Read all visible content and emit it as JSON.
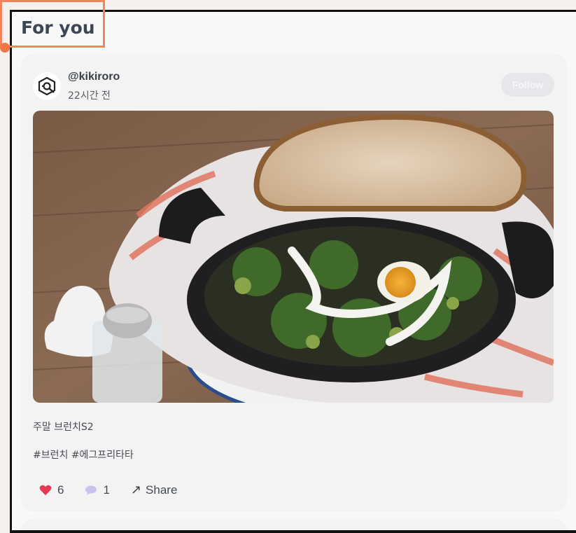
{
  "feed": {
    "section_title": "For you"
  },
  "post": {
    "username": "@kikiroro",
    "time_ago": "22시간 전",
    "follow_label": "Follow",
    "caption": "주말 브런치S2",
    "hashtags": "#브런치 #에그프리타타",
    "likes": "6",
    "comments": "1",
    "share_label": "Share",
    "avatar_icon": "abstract-logo-icon",
    "photo_desc_icon": "food-photo"
  },
  "colors": {
    "highlight": "#f2845b",
    "like": "#e53955",
    "comment": "#c9c3ef",
    "follow_bg": "#e5e7eb"
  }
}
